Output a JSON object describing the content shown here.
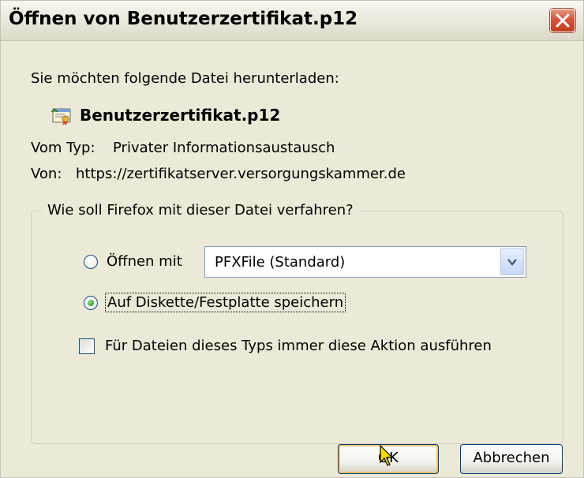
{
  "dialog": {
    "title": "Öffnen von Benutzerzertifikat.p12",
    "intro": "Sie möchten folgende Datei herunterladen:",
    "file": {
      "name": "Benutzerzertifikat.p12",
      "icon": "certificate-file-icon"
    },
    "type_label": "Vom Typ:",
    "type_value": "Privater Informationsaustausch",
    "from_label": "Von:",
    "from_value": "https://zertifikatserver.versorgungskammer.de",
    "group_title": "Wie soll Firefox mit dieser Datei verfahren?",
    "options": {
      "open_label": "Öffnen mit",
      "open_selected": false,
      "open_app": "PFXFile (Standard)",
      "save_label": "Auf Diskette/Festplatte speichern",
      "save_selected": true,
      "always_label": "Für Dateien dieses Typs immer diese Aktion ausführen",
      "always_checked": false
    },
    "buttons": {
      "ok": "OK",
      "cancel": "Abbrechen"
    }
  },
  "colors": {
    "dialog_bg": "#ece9d8",
    "close_button": "#c23a1f",
    "default_button_glow": "#f2c270",
    "radio_selected": "#34a834"
  }
}
